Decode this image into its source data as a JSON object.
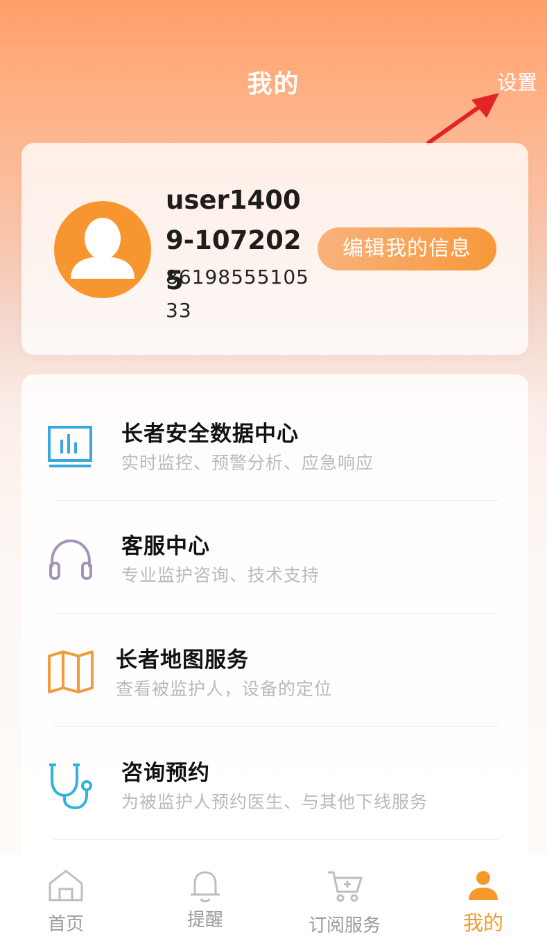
{
  "header": {
    "title": "我的",
    "settings_label": "设置"
  },
  "profile": {
    "username": "user14009-1072025",
    "phone": "8619855510533",
    "edit_label": "编辑我的信息"
  },
  "menu": {
    "items": [
      {
        "title": "长者安全数据中心",
        "subtitle": "实时监控、预警分析、应急响应",
        "icon": "bar-chart-icon",
        "color": "#3aa7e0"
      },
      {
        "title": "客服中心",
        "subtitle": "专业监护咨询、技术支持",
        "icon": "headset-icon",
        "color": "#a394b5"
      },
      {
        "title": "长者地图服务",
        "subtitle": "查看被监护人，设备的定位",
        "icon": "map-icon",
        "color": "#f39a3a"
      },
      {
        "title": "咨询预约",
        "subtitle": "为被监护人预约医生、与其他下线服务",
        "icon": "stethoscope-icon",
        "color": "#31b1e0"
      }
    ]
  },
  "tabbar": {
    "tabs": [
      {
        "label": "首页",
        "icon": "home-icon"
      },
      {
        "label": "提醒",
        "icon": "bell-icon"
      },
      {
        "label": "订阅服务",
        "icon": "cart-icon"
      },
      {
        "label": "我的",
        "icon": "user-icon",
        "active": true
      }
    ],
    "active_color": "#f59a2a",
    "inactive_color": "#9a9a9a"
  }
}
